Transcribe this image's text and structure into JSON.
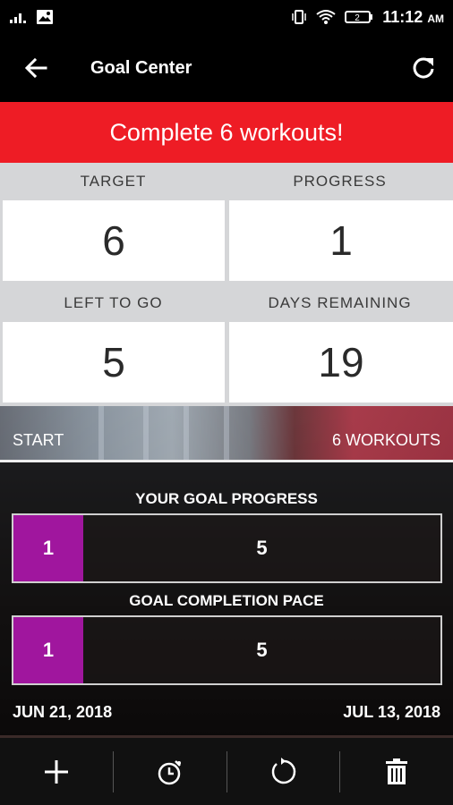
{
  "status": {
    "time": "11:12",
    "ampm": "AM",
    "sim_label": "2"
  },
  "header": {
    "title": "Goal Center"
  },
  "goal": {
    "banner": "Complete 6 workouts!"
  },
  "stats": {
    "target_label": "TARGET",
    "target_value": "6",
    "progress_label": "PROGRESS",
    "progress_value": "1",
    "left_label": "LEFT TO GO",
    "left_value": "5",
    "days_label": "DAYS REMAINING",
    "days_value": "19"
  },
  "range": {
    "start": "START",
    "end": "6 WORKOUTS"
  },
  "goal_progress": {
    "title": "YOUR GOAL PROGRESS",
    "done": "1",
    "remaining": "5",
    "done_fraction": 0.1667
  },
  "completion_pace": {
    "title": "GOAL COMPLETION PACE",
    "done": "1",
    "remaining": "5",
    "done_fraction": 0.1667
  },
  "dates": {
    "start": "JUN 21, 2018",
    "end": "JUL 13, 2018"
  },
  "colors": {
    "accent_red": "#ee1c25",
    "progress_purple": "#a0169e"
  },
  "toolbar": {
    "icons": [
      "add-icon",
      "timer-icon",
      "reset-icon",
      "trash-icon"
    ]
  }
}
